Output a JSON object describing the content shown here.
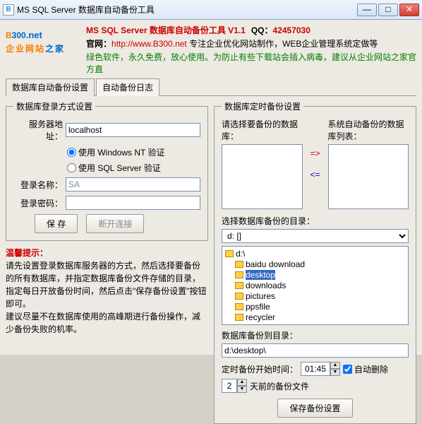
{
  "window": {
    "title": "MS SQL Server 数据库自动备份工具"
  },
  "logo": {
    "b": "B",
    "rest": "300",
    "dot": ".net",
    "tag_a": "企业网站",
    "tag_b": "之家"
  },
  "header": {
    "l1a": "MS SQL Server 数据库自动备份工具 V1.1",
    "l1_qq": "QQ：",
    "l1_qqn": "42457030",
    "l2_pre": "官网：",
    "l2_url": "http://www.B300.net",
    "l2_post": " 专注企业优化网站制作，WEB企业管理系统定做等",
    "l3": "绿色软件，永久免费，放心使用。为防止有些下载站会插入病毒，建议从企业网站之家官方直"
  },
  "tabs": {
    "t1": "数据库自动备份设置",
    "t2": "自动备份日志"
  },
  "left": {
    "legend": "数据库登录方式设置",
    "server_lbl": "服务器地址：",
    "server_val": "localhost",
    "r1": "使用 Windows NT 验证",
    "r2": "使用 SQL Server 验证",
    "login_lbl": "登录名称：",
    "login_val": "SA",
    "pwd_lbl": "登录密码：",
    "pwd_val": "",
    "save": "保 存",
    "disc": "断开连接",
    "hint_t": "温馨提示：",
    "hint": "请先设置登录数据库服务器的方式，然后选择要备份的所有数据库，并指定数据库备份文件存储的目录，指定每日开放备份时间，然后点击\"保存备份设置\"按钮即可。\n建议尽量不在数据库使用的高峰期进行备份操作，减少备份失败的机率。"
  },
  "right": {
    "legend1": "数据库定时备份设置",
    "lst_a": "请选择要备份的数据库：",
    "lst_b": "系统自动备份的数据库列表：",
    "arr_r": "=>",
    "arr_l": "<=",
    "dir_lbl": "选择数据库备份的目录：",
    "drive": "d: []",
    "tree": {
      "root": "d:\\",
      "items": [
        "baidu download",
        "desktop",
        "downloads",
        "pictures",
        "ppsfile",
        "recycler"
      ],
      "selected": "desktop"
    },
    "target_lbl": "数据库备份到目录：",
    "target_val": "d:\\desktop\\",
    "time_lbl": "定时备份开始时间：",
    "time_val": "01:45",
    "auto_del": "自动删除",
    "spin2": "2",
    "days_post": "天前的备份文件",
    "save2": "保存备份设置"
  }
}
